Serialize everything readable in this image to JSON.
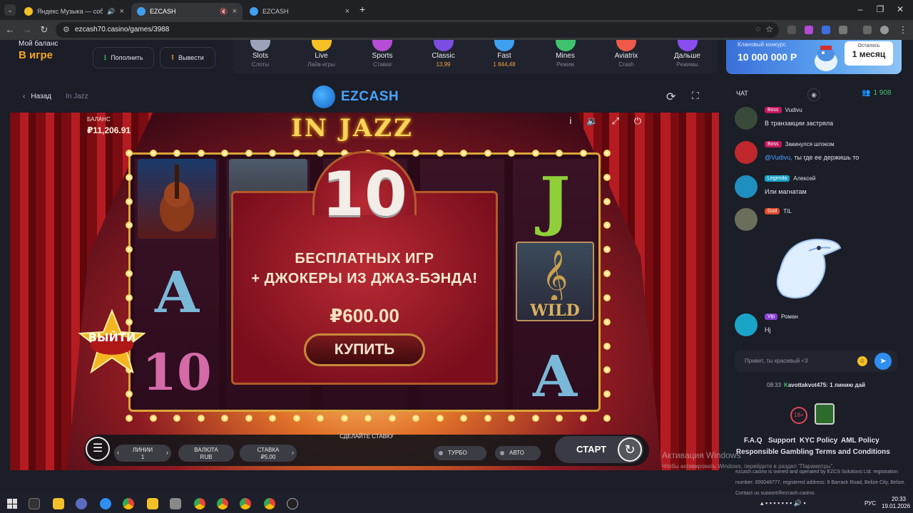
{
  "browser": {
    "tabs": [
      {
        "title": "Яндекс Музыка — собирае",
        "active": false
      },
      {
        "title": "EZCASH",
        "active": true
      },
      {
        "title": "EZCASH",
        "active": false
      }
    ],
    "url": "ezcash70.casino/games/3988"
  },
  "header": {
    "balance_title": "Мой баланс",
    "balance_status": "В игре",
    "deposit_label": "Пополнить",
    "withdraw_label": "Вывести",
    "nav": [
      {
        "label": "Slots",
        "sub": "Слоты",
        "color": "#9aa3b8",
        "accent": false
      },
      {
        "label": "Live",
        "sub": "Лайв-игры",
        "color": "#f5c026",
        "accent": false
      },
      {
        "label": "Sports",
        "sub": "Ставки",
        "color": "#b64dd6",
        "accent": false
      },
      {
        "label": "Classic",
        "sub": "13,99",
        "color": "#7b4de0",
        "accent": true
      },
      {
        "label": "Fast",
        "sub": "1 844,48",
        "color": "#3fa0f0",
        "accent": true
      },
      {
        "label": "Mines",
        "sub": "Режим",
        "color": "#3fc46d",
        "accent": false
      },
      {
        "label": "Aviatrix",
        "sub": "Crash",
        "color": "#f05a4a",
        "accent": false
      },
      {
        "label": "Дальше",
        "sub": "Режимы",
        "color": "#8a4df0",
        "accent": false
      }
    ],
    "promo": {
      "text": "Клановый конкурс",
      "amount": "10 000 000 Р",
      "badge_top": "Осталось",
      "badge_value": "1 месяц"
    }
  },
  "game_head": {
    "back_label": "Назад",
    "game_name": "In Jazz",
    "logo_text": "EZCASH"
  },
  "game": {
    "balance_label": "БАЛАНС",
    "balance_value": "₽11,206.91",
    "title": "IN JAZZ",
    "popup": {
      "number": "10",
      "line1": "БЕСПЛАТНЫХ ИГР",
      "line2": "+ ДЖОКЕРЫ ИЗ ДЖАЗ-БЭНДА!",
      "price": "₽600.00",
      "buy_label": "КУПИТЬ"
    },
    "exit_label": "ВЫЙТИ",
    "symbols": {
      "wild": "WILD",
      "j": "J",
      "a": "A",
      "ten": "10"
    },
    "controls": {
      "place_bet": "СДЕЛАЙТЕ СТАВКУ",
      "lines_label": "ЛИНИИ",
      "lines_value": "1",
      "currency_label": "ВАЛЮТА",
      "currency_value": "RUB",
      "bet_label": "СТАВКА",
      "bet_value": "₽5.00",
      "turbo": "ТУРБО",
      "auto": "АВТО",
      "start": "СТАРТ"
    }
  },
  "chat": {
    "title": "ЧАТ",
    "online": "1 908",
    "messages": [
      {
        "role": "Boss",
        "role_color": "#c2185b",
        "user": "Vudivu",
        "text": "В транзакции застряла",
        "avatar_color": "#3a4a3a"
      },
      {
        "role": "Boss",
        "role_color": "#c2185b",
        "user": "Закинулся шпэком",
        "mention": "@Vudivu,",
        "text": " ты где ее держишь то",
        "avatar_color": "#c0282e"
      },
      {
        "role": "Legenda",
        "role_color": "#1aa4c8",
        "user": "Алексей",
        "text": "Или магнатам",
        "avatar_color": "#1f8fbf"
      },
      {
        "role": "God",
        "role_color": "#e04a2a",
        "user": "TIL",
        "text": "",
        "avatar_color": "#6a6e5a"
      },
      {
        "role": "Vip",
        "role_color": "#8b3fd1",
        "user": "Роман",
        "text": "Hj",
        "avatar_color": "#1aa4c8"
      }
    ],
    "input_placeholder": "Привет, ты красивый <3",
    "ticker_time": "08:33",
    "ticker_user": "avottakvot475:",
    "ticker_text": " 1 линию дай"
  },
  "footer": {
    "age": "18+",
    "links": [
      "F.A.Q",
      "Support",
      "KYC Policy",
      "AML Policy",
      "Responsible Gambling",
      "Terms and Conditions"
    ],
    "legal": "ezcash.casino is owned and operated by EZCS Solutions Ltd. registration number: 000048777, registered address: 9 Barrack Road, Belize City, Belize. Contact us support@ezcash.casino.",
    "activate_title": "Активация Windows",
    "activate_text": "Чтобы активировать Windows, перейдите в раздел \"Параметры\"."
  },
  "taskbar": {
    "lang": "РУС",
    "time": "20:33",
    "date": "19.01.2026"
  }
}
